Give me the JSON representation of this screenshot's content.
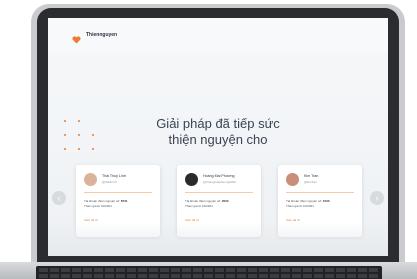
{
  "header": {
    "brand_name": "Thiennguyen"
  },
  "hero": {
    "headline_line1": "Giải pháp đã tiếp sức",
    "headline_line2": "thiện nguyện cho"
  },
  "cards": [
    {
      "name": "Thái Thuỳ Linh",
      "handle": "@thailinh.tl",
      "accounts_prefix": "Tài khoản thiện nguyện số:",
      "accounts_number": "8731",
      "joined": "Tham gia từ 10/2021",
      "link": "Xem tài từ",
      "avatar_color": "#d9b49a"
    },
    {
      "name": "Hoàng Mai Phương",
      "handle": "@hoangmaiphuong2022",
      "accounts_prefix": "Tài khoản thiện nguyện số:",
      "accounts_number": "2000",
      "joined": "Tham gia từ 10/2021",
      "link": "Xem tài từ",
      "avatar_color": "#2b2b2e"
    },
    {
      "name": "Kim Tran",
      "handle": "@kimtran",
      "accounts_prefix": "Tài khoản thiện nguyện số:",
      "accounts_number": "1000",
      "joined": "Tham gia từ 10/2021",
      "link": "Xem tài từ",
      "avatar_color": "#c98f78"
    }
  ],
  "navigation": {
    "prev_icon": "chevron-left-icon",
    "next_icon": "chevron-right-icon",
    "prev_glyph": "‹",
    "next_glyph": "›"
  },
  "colors": {
    "accent": "#f07a2f",
    "bezel": "#2a2c30"
  }
}
